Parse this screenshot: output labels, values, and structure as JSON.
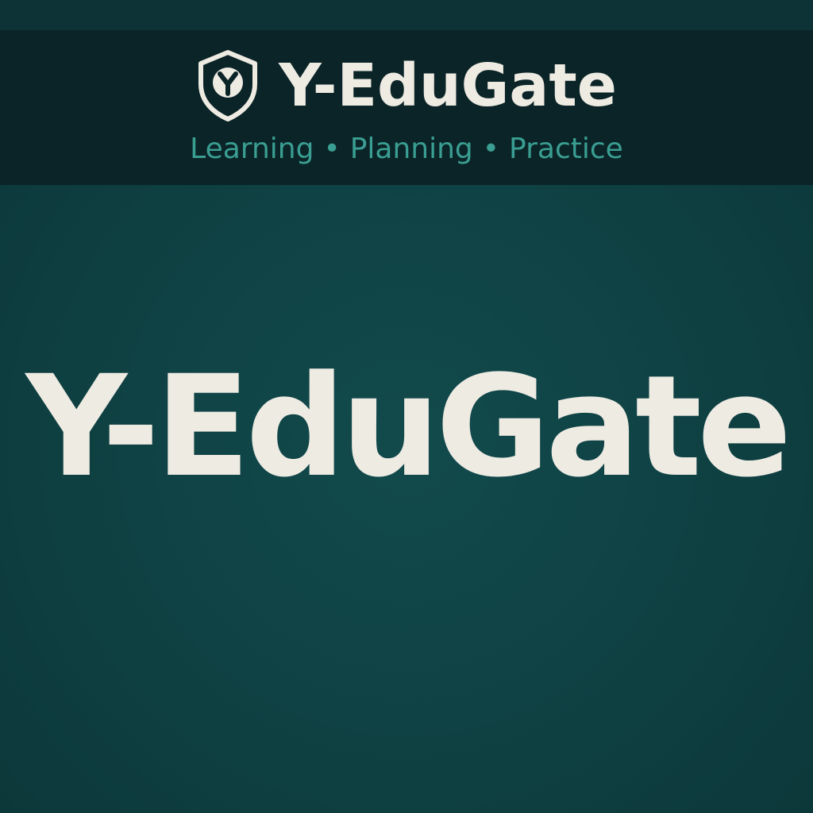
{
  "header": {
    "logo_icon": "shield-y-icon",
    "brand_name": "Y-EduGate",
    "tagline_items": [
      "Learning",
      "Planning",
      "Practice"
    ],
    "tagline_separator": "•"
  },
  "hero": {
    "title": "Y-EduGate"
  },
  "colors": {
    "background": "#0f4244",
    "header_background": "#0b2427",
    "text_light": "#eeebe3",
    "accent_teal": "#3a9e92"
  }
}
